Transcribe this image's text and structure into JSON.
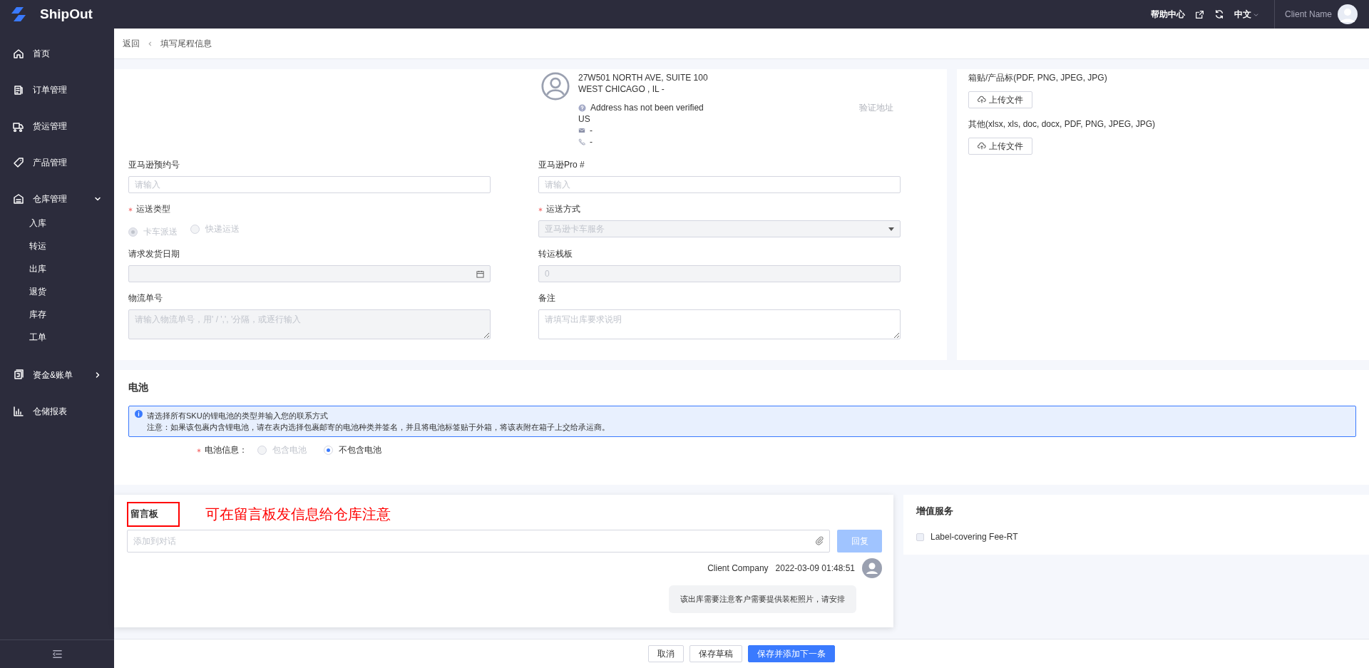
{
  "topbar": {
    "logo": "ShipOut",
    "help": "帮助中心",
    "language": "中文",
    "user": "Client Name"
  },
  "sidebar": {
    "items": [
      {
        "label": "首页",
        "kind": "link"
      },
      {
        "label": "订单管理",
        "kind": "link"
      },
      {
        "label": "货运管理",
        "kind": "link"
      },
      {
        "label": "产品管理",
        "kind": "link"
      },
      {
        "label": "仓库管理",
        "kind": "group",
        "expanded": true,
        "children": [
          {
            "label": "入库"
          },
          {
            "label": "转运"
          },
          {
            "label": "出库"
          },
          {
            "label": "退货"
          },
          {
            "label": "库存"
          },
          {
            "label": "工单"
          }
        ]
      },
      {
        "label": "资金&账单",
        "kind": "group",
        "expanded": false
      },
      {
        "label": "仓储报表",
        "kind": "link"
      }
    ]
  },
  "breadcrumb": {
    "back": "返回",
    "current": "填写尾程信息"
  },
  "address": {
    "lines": [
      "27W501 NORTH AVE, SUITE 100",
      "WEST CHICAGO , IL -"
    ],
    "verify_status": "Address has not been verified",
    "country": "US",
    "email": "-",
    "phone": "-",
    "verify_link": "验证地址"
  },
  "fields": [
    {
      "label": "亚马逊预约号",
      "required": false,
      "kind": "input",
      "placeholder": "请输入",
      "disabled": false
    },
    {
      "label": "亚马逊Pro #",
      "required": false,
      "kind": "input",
      "placeholder": "请输入",
      "disabled": false
    },
    {
      "label": "运送类型",
      "required": true,
      "kind": "radio",
      "disabled": true,
      "options": [
        {
          "label": "卡车派送",
          "selected": true
        },
        {
          "label": "快递运送",
          "selected": false
        }
      ]
    },
    {
      "label": "运送方式",
      "required": true,
      "kind": "select",
      "value": "亚马逊卡车服务",
      "disabled": true
    },
    {
      "label": "请求发货日期",
      "required": false,
      "kind": "date",
      "disabled": true
    },
    {
      "label": "转运栈板",
      "required": false,
      "kind": "input",
      "value": "0",
      "disabled": true
    },
    {
      "label": "物流单号",
      "required": false,
      "kind": "textarea",
      "placeholder": "请输入物流单号，用' / ',', '分隔，或逐行输入",
      "disabled": true
    },
    {
      "label": "备注",
      "required": false,
      "kind": "textarea",
      "placeholder": "请填写出库要求说明",
      "disabled": false
    }
  ],
  "uploads": [
    {
      "label": "箱贴/产品标(PDF, PNG, JPEG, JPG)",
      "button": "上传文件"
    },
    {
      "label": "其他(xlsx, xls, doc, docx, PDF, PNG, JPEG, JPG)",
      "button": "上传文件"
    }
  ],
  "battery": {
    "title": "电池",
    "notice": [
      "请选择所有SKU的锂电池的类型并输入您的联系方式",
      "注意：如果该包裹内含锂电池，请在表内选择包裹邮寄的电池种类并签名，并且将电池标签贴于外箱，将该表附在箱子上交给承运商。"
    ],
    "field": {
      "label": "电池信息：",
      "required": true,
      "options": [
        {
          "label": "包含电池",
          "selected": false,
          "disabled": true
        },
        {
          "label": "不包含电池",
          "selected": true,
          "disabled": false
        }
      ]
    }
  },
  "message_board": {
    "title": "留言板",
    "annotation": "可在留言板发信息给仓库注意",
    "input": {
      "placeholder": "添加到对话"
    },
    "reply_button": {
      "label": "回复",
      "disabled": true
    },
    "messages": [
      {
        "author": "Client Company",
        "time": "2022-03-09 01:48:51",
        "text": "该出库需要注意客户需要提供装柜照片，请安排"
      }
    ]
  },
  "value_added": {
    "title": "增值服务",
    "items": [
      {
        "label": "Label-covering Fee-RT",
        "checked": false
      }
    ]
  },
  "footer": {
    "buttons": [
      {
        "label": "取消",
        "kind": "default"
      },
      {
        "label": "保存草稿",
        "kind": "default"
      },
      {
        "label": "保存并添加下一条",
        "kind": "primary"
      }
    ]
  }
}
